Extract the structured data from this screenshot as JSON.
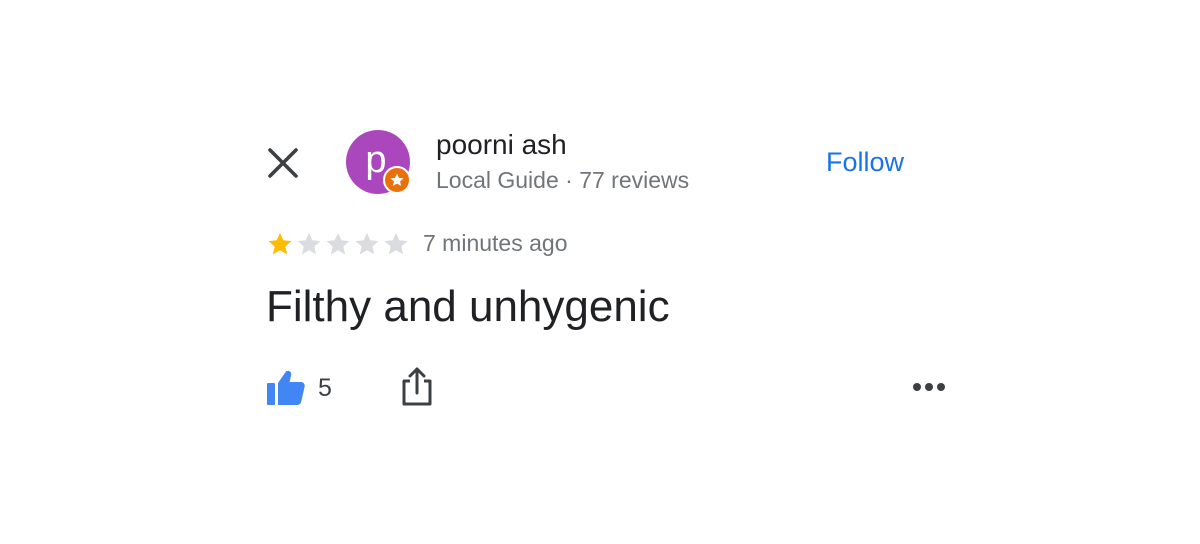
{
  "review": {
    "reviewer": {
      "initial": "p",
      "name": "poorni ash",
      "meta": "Local Guide · 77 reviews",
      "avatar_color": "#ab47bc",
      "badge_color": "#e8710a",
      "badge_icon": "star-icon"
    },
    "follow_label": "Follow",
    "rating": 1,
    "rating_max": 5,
    "time": "7 minutes ago",
    "text": "Filthy and unhygenic",
    "likes": "5"
  },
  "icons": {
    "close": "close-icon",
    "like": "thumbs-up-icon",
    "share": "share-icon",
    "more": "more-horizontal-icon"
  },
  "colors": {
    "accent": "#1a73e8",
    "star_filled": "#fbbc04",
    "star_empty": "#dadce0",
    "secondary_text": "#70757a"
  }
}
